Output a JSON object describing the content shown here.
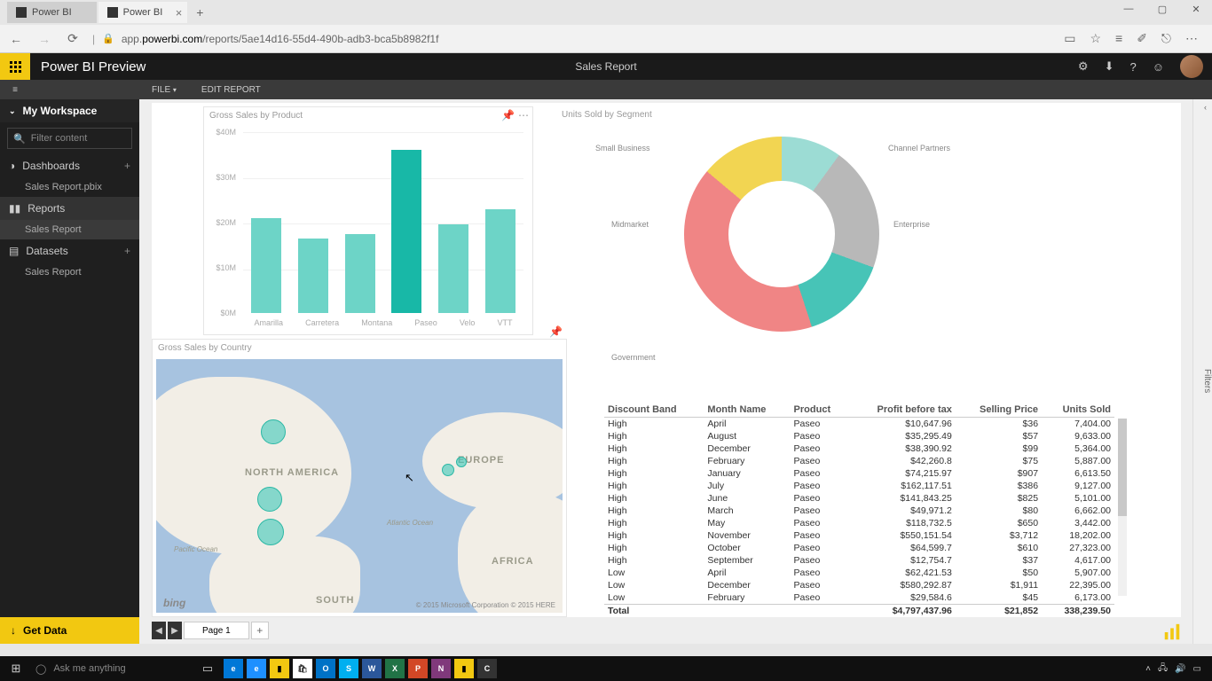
{
  "browser": {
    "tabs": [
      {
        "label": "Power BI",
        "active": false
      },
      {
        "label": "Power BI",
        "active": true
      }
    ],
    "url_prefix": "app.",
    "url_domain": "powerbi.com",
    "url_path": "/reports/5ae14d16-55d4-490b-adb3-bca5b8982f1f"
  },
  "header": {
    "app_title": "Power BI Preview",
    "report_title": "Sales Report",
    "menu_file": "FILE",
    "menu_edit": "EDIT REPORT"
  },
  "sidebar": {
    "workspace": "My Workspace",
    "search_placeholder": "Filter content",
    "sections": {
      "dashboards": "Dashboards",
      "dashboards_items": [
        "Sales Report.pbix"
      ],
      "reports": "Reports",
      "reports_items": [
        "Sales Report"
      ],
      "datasets": "Datasets",
      "datasets_items": [
        "Sales Report"
      ]
    },
    "get_data": "Get Data"
  },
  "filters_label": "Filters",
  "page_tab": "Page 1",
  "chart_data": [
    {
      "type": "bar",
      "title": "Gross Sales by Product",
      "categories": [
        "Amarilla",
        "Carretera",
        "Montana",
        "Paseo",
        "Velo",
        "VTT"
      ],
      "values": [
        21,
        16.5,
        17.5,
        36,
        19.5,
        23
      ],
      "ylabel": "",
      "xlabel": "",
      "y_ticks": [
        "$40M",
        "$30M",
        "$20M",
        "$10M",
        "$0M"
      ],
      "ylim": [
        0,
        40
      ]
    },
    {
      "type": "donut",
      "title": "Units Sold by Segment",
      "series": [
        {
          "name": "Channel Partners",
          "value": 10,
          "color": "#9cdcd4"
        },
        {
          "name": "Enterprise",
          "value": 21,
          "color": "#b8b8b8"
        },
        {
          "name": "Government",
          "value": 41,
          "color": "#f08585"
        },
        {
          "name": "Midmarket",
          "value": 14,
          "color": "#f2d552"
        },
        {
          "name": "Small Business",
          "value": 14,
          "color": "#47c4b7"
        }
      ]
    },
    {
      "type": "map",
      "title": "Gross Sales by Country",
      "labels": [
        "NORTH AMERICA",
        "EUROPE",
        "AFRICA",
        "SOUTH"
      ],
      "ocean_labels": [
        "Pacific Ocean",
        "Atlantic Ocean"
      ],
      "credits": "© 2015 Microsoft Corporation    © 2015 HERE",
      "provider": "bing"
    },
    {
      "type": "table",
      "columns": [
        "Discount Band",
        "Month Name",
        "Product",
        "Profit before tax",
        "Selling Price",
        "Units Sold"
      ],
      "rows": [
        [
          "High",
          "April",
          "Paseo",
          "$10,647.96",
          "$36",
          "7,404.00"
        ],
        [
          "High",
          "August",
          "Paseo",
          "$35,295.49",
          "$57",
          "9,633.00"
        ],
        [
          "High",
          "December",
          "Paseo",
          "$38,390.92",
          "$99",
          "5,364.00"
        ],
        [
          "High",
          "February",
          "Paseo",
          "$42,260.8",
          "$75",
          "5,887.00"
        ],
        [
          "High",
          "January",
          "Paseo",
          "$74,215.97",
          "$907",
          "6,613.50"
        ],
        [
          "High",
          "July",
          "Paseo",
          "$162,117.51",
          "$386",
          "9,127.00"
        ],
        [
          "High",
          "June",
          "Paseo",
          "$141,843.25",
          "$825",
          "5,101.00"
        ],
        [
          "High",
          "March",
          "Paseo",
          "$49,971.2",
          "$80",
          "6,662.00"
        ],
        [
          "High",
          "May",
          "Paseo",
          "$118,732.5",
          "$650",
          "3,442.00"
        ],
        [
          "High",
          "November",
          "Paseo",
          "$550,151.54",
          "$3,712",
          "18,202.00"
        ],
        [
          "High",
          "October",
          "Paseo",
          "$64,599.7",
          "$610",
          "27,323.00"
        ],
        [
          "High",
          "September",
          "Paseo",
          "$12,754.7",
          "$37",
          "4,617.00"
        ],
        [
          "Low",
          "April",
          "Paseo",
          "$62,421.53",
          "$50",
          "5,907.00"
        ],
        [
          "Low",
          "December",
          "Paseo",
          "$580,292.87",
          "$1,911",
          "22,395.00"
        ],
        [
          "Low",
          "February",
          "Paseo",
          "$29,584.6",
          "$45",
          "6,173.00"
        ]
      ],
      "total": [
        "Total",
        "",
        "",
        "$4,797,437.96",
        "$21,852",
        "338,239.50"
      ]
    }
  ],
  "donut_labels": {
    "sb": "Small Business",
    "cp": "Channel Partners",
    "ent": "Enterprise",
    "gov": "Government",
    "mm": "Midmarket"
  },
  "taskbar": {
    "search": "Ask me anything"
  }
}
